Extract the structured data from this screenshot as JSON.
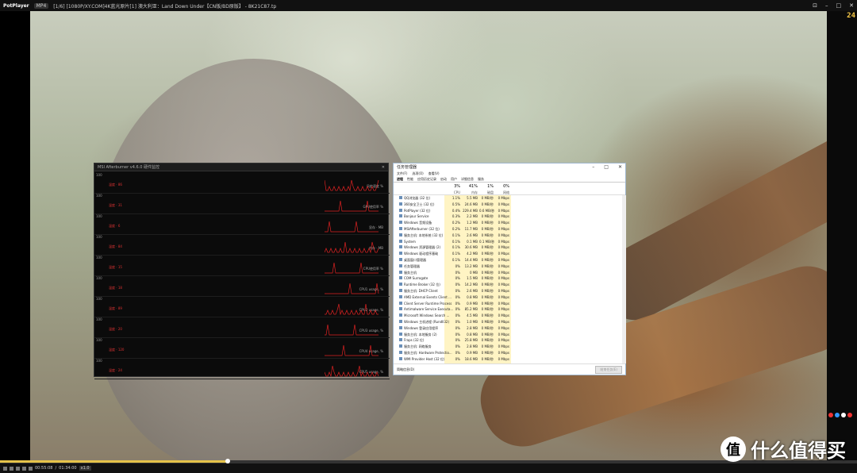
{
  "player": {
    "brand": "PotPlayer",
    "tag": "MP4",
    "title": "[1/6] [1080P/XY.COM]4K蓝光原片[1] 澳大利亚：Land Down Under【CN版/BD原版】 -  8K21C87.tp",
    "fps": "24",
    "time": "00:55:08",
    "duration": "01:34:00",
    "progress_fraction": 0.266,
    "speed_tag": "x1.0"
  },
  "afterburner": {
    "title": "MSI Afterburner v4.6.0 硬件监控",
    "rows": [
      {
        "label": "100",
        "value": "温度 · 86",
        "right": "风扇速度 %"
      },
      {
        "label": "100",
        "value": "温度 · 31",
        "right": "GPU使用率 %"
      },
      {
        "label": "100",
        "value": "温度 · 6",
        "right": "显存 · MB"
      },
      {
        "label": "100",
        "value": "温度 · 84",
        "right": "内存 · MB"
      },
      {
        "label": "100",
        "value": "温度 · 15",
        "right": "CPU使用率 %"
      },
      {
        "label": "100",
        "value": "温度 · 18",
        "right": "CPU1 usage, %"
      },
      {
        "label": "100",
        "value": "温度 · 89",
        "right": "CPU2 usage, %"
      },
      {
        "label": "100",
        "value": "温度 · 20",
        "right": "CPU3 usage, %"
      },
      {
        "label": "100",
        "value": "温度 · 120",
        "right": "CPU4 usage, %"
      },
      {
        "label": "100",
        "value": "温度 · 24",
        "right": "CPU5 usage, %"
      }
    ]
  },
  "taskmgr": {
    "title": "任务管理器",
    "menu": [
      "文件(F)",
      "选项(O)",
      "查看(V)"
    ],
    "tabs": [
      "进程",
      "性能",
      "应用历史记录",
      "启动",
      "用户",
      "详细信息",
      "服务"
    ],
    "head": {
      "cpu_pct": "3%",
      "cpu_name": "CPU",
      "mem_pct": "41%",
      "mem_name": "内存",
      "disk_pct": "1%",
      "disk_name": "磁盘",
      "net_pct": "0%",
      "net_name": "网络"
    },
    "rows": [
      {
        "name": "QQ浏览器 (32 位)",
        "cpu": "1.1%",
        "mem": "5.5 MB",
        "disk": "0 MB/秒",
        "net": "0 Mbps"
      },
      {
        "name": "360安全卫士 (32 位)",
        "cpu": "0.5%",
        "mem": "24.6 MB",
        "disk": "0 MB/秒",
        "net": "0 Mbps"
      },
      {
        "name": "PotPlayer (32 位)",
        "cpu": "0.4%",
        "mem": "229.4 MB",
        "disk": "0.6 MB/秒",
        "net": "0 Mbps"
      },
      {
        "name": "Bonjour Service",
        "cpu": "0.3%",
        "mem": "2.2 MB",
        "disk": "0 MB/秒",
        "net": "0 Mbps"
      },
      {
        "name": "Windows 音频设备",
        "cpu": "0.2%",
        "mem": "1.2 MB",
        "disk": "0 MB/秒",
        "net": "0 Mbps"
      },
      {
        "name": "MSIAfterburner (32 位)",
        "cpu": "0.2%",
        "mem": "11.7 MB",
        "disk": "0 MB/秒",
        "net": "0 Mbps"
      },
      {
        "name": "服务主机: 本地系统 (32 位)",
        "cpu": "0.1%",
        "mem": "2.6 MB",
        "disk": "0 MB/秒",
        "net": "0 Mbps"
      },
      {
        "name": "System",
        "cpu": "0.1%",
        "mem": "0.1 MB",
        "disk": "0.1 MB/秒",
        "net": "0 Mbps"
      },
      {
        "name": "Windows 资源管理器 (2)",
        "cpu": "0.1%",
        "mem": "30.6 MB",
        "disk": "0 MB/秒",
        "net": "0 Mbps"
      },
      {
        "name": "Windows 驱动程序基础",
        "cpu": "0.1%",
        "mem": "4.2 MB",
        "disk": "0 MB/秒",
        "net": "0 Mbps"
      },
      {
        "name": "桌面窗口管理器",
        "cpu": "0.1%",
        "mem": "14.4 MB",
        "disk": "0 MB/秒",
        "net": "0 Mbps"
      },
      {
        "name": "任务管理器",
        "cpu": "0%",
        "mem": "13.2 MB",
        "disk": "0 MB/秒",
        "net": "0 Mbps"
      },
      {
        "name": "服务主机",
        "cpu": "0%",
        "mem": "0 MB",
        "disk": "0 MB/秒",
        "net": "0 Mbps"
      },
      {
        "name": "COM Surrogate",
        "cpu": "0%",
        "mem": "1.5 MB",
        "disk": "0 MB/秒",
        "net": "0 Mbps"
      },
      {
        "name": "Runtime Broker (32 位)",
        "cpu": "0%",
        "mem": "14.2 MB",
        "disk": "0 MB/秒",
        "net": "0 Mbps"
      },
      {
        "name": "服务主机: DHCP Client",
        "cpu": "0%",
        "mem": "2.6 MB",
        "disk": "0 MB/秒",
        "net": "0 Mbps"
      },
      {
        "name": "AMD External Events Client ...",
        "cpu": "0%",
        "mem": "0.8 MB",
        "disk": "0 MB/秒",
        "net": "0 Mbps"
      },
      {
        "name": "Client Server Runtime Process",
        "cpu": "0%",
        "mem": "0.9 MB",
        "disk": "0 MB/秒",
        "net": "0 Mbps"
      },
      {
        "name": "Antimalware Service Executa...",
        "cpu": "0%",
        "mem": "85.2 MB",
        "disk": "0 MB/秒",
        "net": "0 Mbps"
      },
      {
        "name": "Microsoft Windows Search ...",
        "cpu": "0%",
        "mem": "4.5 MB",
        "disk": "0 MB/秒",
        "net": "0 Mbps"
      },
      {
        "name": "Windows 主机进程 (Rundll32)",
        "cpu": "0%",
        "mem": "1.0 MB",
        "disk": "0 MB/秒",
        "net": "0 Mbps"
      },
      {
        "name": "Windows 登录应用程序",
        "cpu": "0%",
        "mem": "2.8 MB",
        "disk": "0 MB/秒",
        "net": "0 Mbps"
      },
      {
        "name": "服务主机: 本地服务 (2)",
        "cpu": "0%",
        "mem": "0.8 MB",
        "disk": "0 MB/秒",
        "net": "0 Mbps"
      },
      {
        "name": "Fraps (32 位)",
        "cpu": "0%",
        "mem": "25.8 MB",
        "disk": "0 MB/秒",
        "net": "0 Mbps"
      },
      {
        "name": "服务主机: 网络服务",
        "cpu": "0%",
        "mem": "2.8 MB",
        "disk": "0 MB/秒",
        "net": "0 Mbps"
      },
      {
        "name": "服务主机: Hardware Protectio...",
        "cpu": "0%",
        "mem": "0.9 MB",
        "disk": "0 MB/秒",
        "net": "0 Mbps"
      },
      {
        "name": "WMI Provider Host (32 位)",
        "cpu": "0%",
        "mem": "18.6 MB",
        "disk": "0 MB/秒",
        "net": "0 Mbps"
      }
    ],
    "footer_left": "简略信息(D)",
    "footer_button": "结束任务(E)"
  },
  "watermark": {
    "logo": "值",
    "text": "什么值得买"
  }
}
